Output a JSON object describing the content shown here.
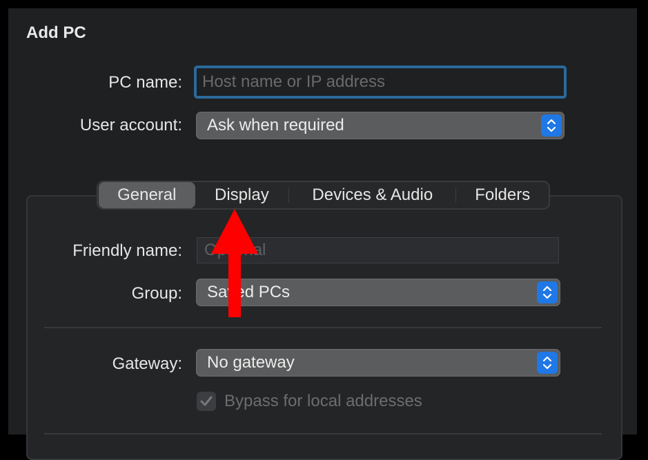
{
  "dialog": {
    "title": "Add PC",
    "pc_name": {
      "label": "PC name:",
      "value": "",
      "placeholder": "Host name or IP address"
    },
    "user_account": {
      "label": "User account:",
      "value": "Ask when required"
    }
  },
  "tabs": [
    {
      "label": "General",
      "active": true
    },
    {
      "label": "Display",
      "active": false
    },
    {
      "label": "Devices & Audio",
      "active": false
    },
    {
      "label": "Folders",
      "active": false
    }
  ],
  "general": {
    "friendly_name": {
      "label": "Friendly name:",
      "value": "",
      "placeholder": "Optional"
    },
    "group": {
      "label": "Group:",
      "value": "Saved PCs"
    },
    "gateway": {
      "label": "Gateway:",
      "value": "No gateway"
    },
    "bypass": {
      "label": "Bypass for local addresses",
      "checked": true,
      "enabled": false
    }
  },
  "annotation": {
    "type": "arrow",
    "direction": "up",
    "target": "Display tab",
    "color": "#ff0000"
  },
  "colors": {
    "accent": "#1f78e6",
    "focus_ring": "#2b6a9c"
  }
}
